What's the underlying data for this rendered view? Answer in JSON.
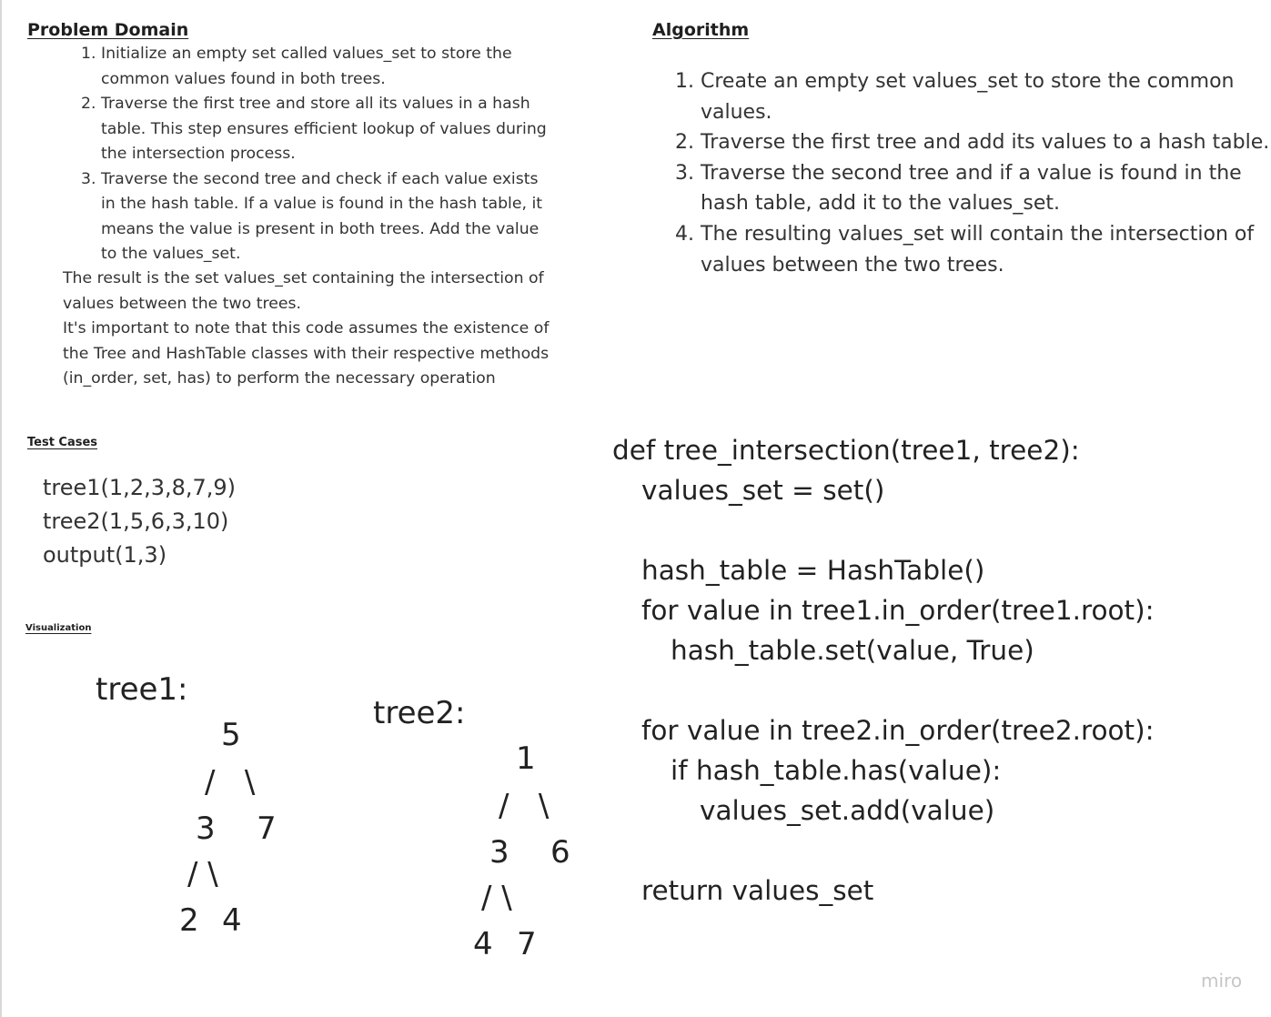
{
  "problem_domain": {
    "title": "Problem Domain",
    "steps": [
      "Initialize an empty set called values_set to store the common values found in both trees.",
      "Traverse the first tree and store all its values in a hash table. This step ensures efficient lookup of values during the intersection process.",
      "Traverse the second tree and check if each value exists in the hash table. If a value is found in the hash table, it means the value is present in both trees. Add the value to the values_set."
    ],
    "result_note": "The result is the set values_set containing the intersection of values between the two trees.",
    "assumption_note": "It's important to note that this code assumes the existence of the Tree and HashTable classes with their respective methods (in_order, set, has) to perform the necessary operation"
  },
  "algorithm": {
    "title": "Algorithm",
    "steps": [
      "Create an empty set values_set to store the common values.",
      "Traverse the first tree and add its values to a hash table.",
      "Traverse the second tree and if a value is found in the hash table, add it to the values_set.",
      "The resulting values_set will contain the intersection of values between the two trees."
    ]
  },
  "test_cases": {
    "title": "Test Cases",
    "lines": [
      "tree1(1,2,3,8,7,9)",
      "tree2(1,5,6,3,10)",
      "output(1,3)"
    ]
  },
  "visualization": {
    "title": "Visualization",
    "tree1": {
      "label": "tree1:",
      "root": "5",
      "branch1": "/   \\",
      "level1_left": "3",
      "level1_right": "7",
      "branch2": "/ \\",
      "level2_left": "2",
      "level2_right": "4"
    },
    "tree2": {
      "label": "tree2:",
      "root": "1",
      "branch1": "/   \\",
      "level1_left": "3",
      "level1_right": "6",
      "branch2": "/ \\",
      "level2_left": "4",
      "level2_right": "7"
    }
  },
  "code": {
    "lines": [
      "def tree_intersection(tree1, tree2):",
      "values_set = set()",
      "hash_table = HashTable()",
      "for value in tree1.in_order(tree1.root):",
      "hash_table.set(value, True)",
      "for value in tree2.in_order(tree2.root):",
      "if hash_table.has(value):",
      "values_set.add(value)",
      "return values_set"
    ]
  },
  "watermark": "miro"
}
